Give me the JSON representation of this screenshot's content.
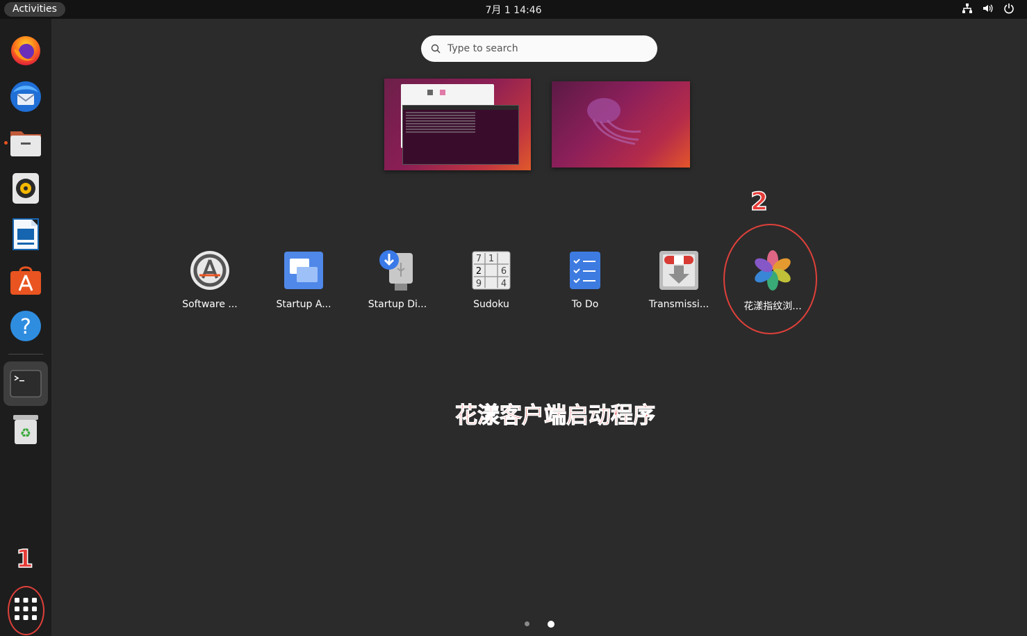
{
  "topbar": {
    "activities_label": "Activities",
    "clock": "7月 1  14:46",
    "tray_icons": [
      "network-icon",
      "volume-icon",
      "power-icon"
    ]
  },
  "dock": {
    "items": [
      {
        "name": "firefox",
        "icon": "firefox-icon",
        "running": false
      },
      {
        "name": "thunderbird",
        "icon": "thunderbird-icon",
        "running": false
      },
      {
        "name": "files",
        "icon": "files-icon",
        "running": true
      },
      {
        "name": "rhythmbox",
        "icon": "rhythmbox-icon",
        "running": false
      },
      {
        "name": "libreoffice-writer",
        "icon": "writer-icon",
        "running": false
      },
      {
        "name": "ubuntu-software",
        "icon": "software-store-icon",
        "running": false
      },
      {
        "name": "help",
        "icon": "help-icon",
        "running": false
      },
      {
        "name": "terminal",
        "icon": "terminal-icon",
        "running": true
      },
      {
        "name": "trash",
        "icon": "trash-icon",
        "running": false
      }
    ],
    "show_apps_icon": "app-grid-icon"
  },
  "search": {
    "placeholder": "Type to search"
  },
  "apps": [
    {
      "label": "Software ...",
      "icon": "software-updater-icon"
    },
    {
      "label": "Startup A...",
      "icon": "startup-applications-icon"
    },
    {
      "label": "Startup Di...",
      "icon": "startup-disk-creator-icon"
    },
    {
      "label": "Sudoku",
      "icon": "sudoku-icon"
    },
    {
      "label": "To Do",
      "icon": "todo-icon"
    },
    {
      "label": "Transmissi...",
      "icon": "transmission-icon"
    },
    {
      "label": "花漾指纹浏...",
      "icon": "fingerprint-browser-icon"
    }
  ],
  "sudoku_digits": [
    "7",
    "1",
    "2",
    "6",
    "9",
    "4"
  ],
  "annotations": {
    "step1": "1",
    "step2": "2",
    "caption": "花漾客户端启动程序",
    "color": "#e53b37"
  },
  "pager": {
    "pages": 2,
    "current": 2
  },
  "colors": {
    "ubuntu_orange": "#e95420",
    "panel": "#131313",
    "dock": "#1d1d1d",
    "background": "#2b2b2b"
  }
}
